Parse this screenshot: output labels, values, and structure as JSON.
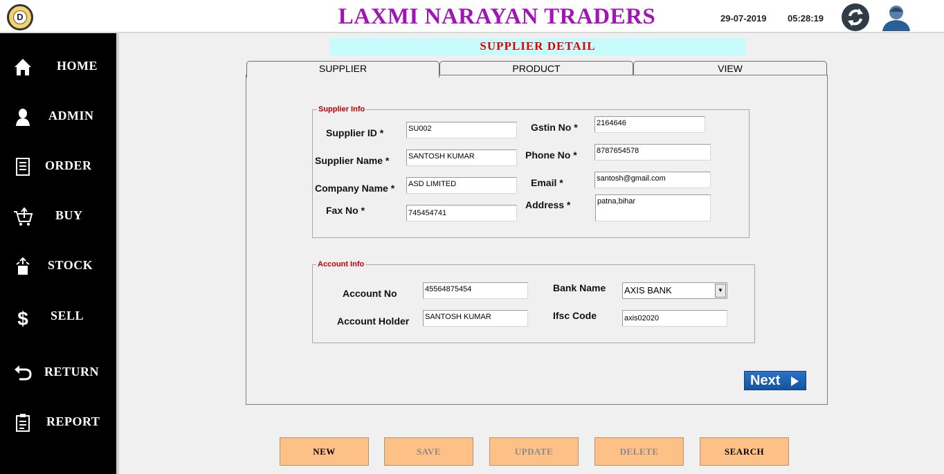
{
  "header": {
    "logo_letter": "D",
    "title": "LAXMI NARAYAN TRADERS",
    "date": "29-07-2019",
    "time": "05:28:19"
  },
  "icons": {
    "refresh": "refresh-icon",
    "user": "user-icon"
  },
  "sidebar": {
    "items": [
      {
        "label": "HOME",
        "icon": "home-icon"
      },
      {
        "label": "ADMIN",
        "icon": "admin-icon"
      },
      {
        "label": "ORDER",
        "icon": "order-icon"
      },
      {
        "label": "BUY",
        "icon": "buy-cart-icon"
      },
      {
        "label": "STOCK",
        "icon": "stock-icon"
      },
      {
        "label": "SELL",
        "icon": "dollar-icon"
      },
      {
        "label": "RETURN",
        "icon": "return-icon"
      },
      {
        "label": "REPORT",
        "icon": "report-icon"
      }
    ]
  },
  "page_title": "SUPPLIER  DETAIL",
  "tabs": [
    {
      "label": "SUPPLIER",
      "active": true
    },
    {
      "label": "PRODUCT",
      "active": false
    },
    {
      "label": "VIEW",
      "active": false
    }
  ],
  "supplier_info": {
    "title": "Supplier Info",
    "supplier_id": {
      "label": "Supplier ID  *",
      "value": "SU002"
    },
    "supplier_name": {
      "label": "Supplier Name  *",
      "value": "SANTOSH KUMAR"
    },
    "company_name": {
      "label": "Company Name  *",
      "value": "ASD LIMITED"
    },
    "fax_no": {
      "label": "Fax No  *",
      "value": "745454741"
    },
    "gstin_no": {
      "label": "Gstin No  *",
      "value": "2164646"
    },
    "phone_no": {
      "label": "Phone No  *",
      "value": "8787654578"
    },
    "email": {
      "label": "Email  *",
      "value": "santosh@gmail.com"
    },
    "address": {
      "label": "Address  *",
      "value": "patna,bihar"
    }
  },
  "account_info": {
    "title": "Account Info",
    "account_no": {
      "label": "Account No",
      "value": "45564875454"
    },
    "account_holder": {
      "label": "Account Holder",
      "value": "SANTOSH KUMAR"
    },
    "bank_name": {
      "label": "Bank Name",
      "value": "AXIS BANK"
    },
    "ifsc_code": {
      "label": "Ifsc Code",
      "value": "axis02020"
    }
  },
  "next_button": "Next",
  "actions": {
    "new": "NEW",
    "save": "SAVE",
    "update": "UPDATE",
    "delete": "DELETE",
    "search": "SEARCH"
  },
  "colors": {
    "title": "#a213b8",
    "banner_bg": "#c8fbfb",
    "banner_text": "#e00000",
    "action_button": "#fdc086",
    "next_button": "#1f64b5",
    "sidebar": "#000000"
  }
}
